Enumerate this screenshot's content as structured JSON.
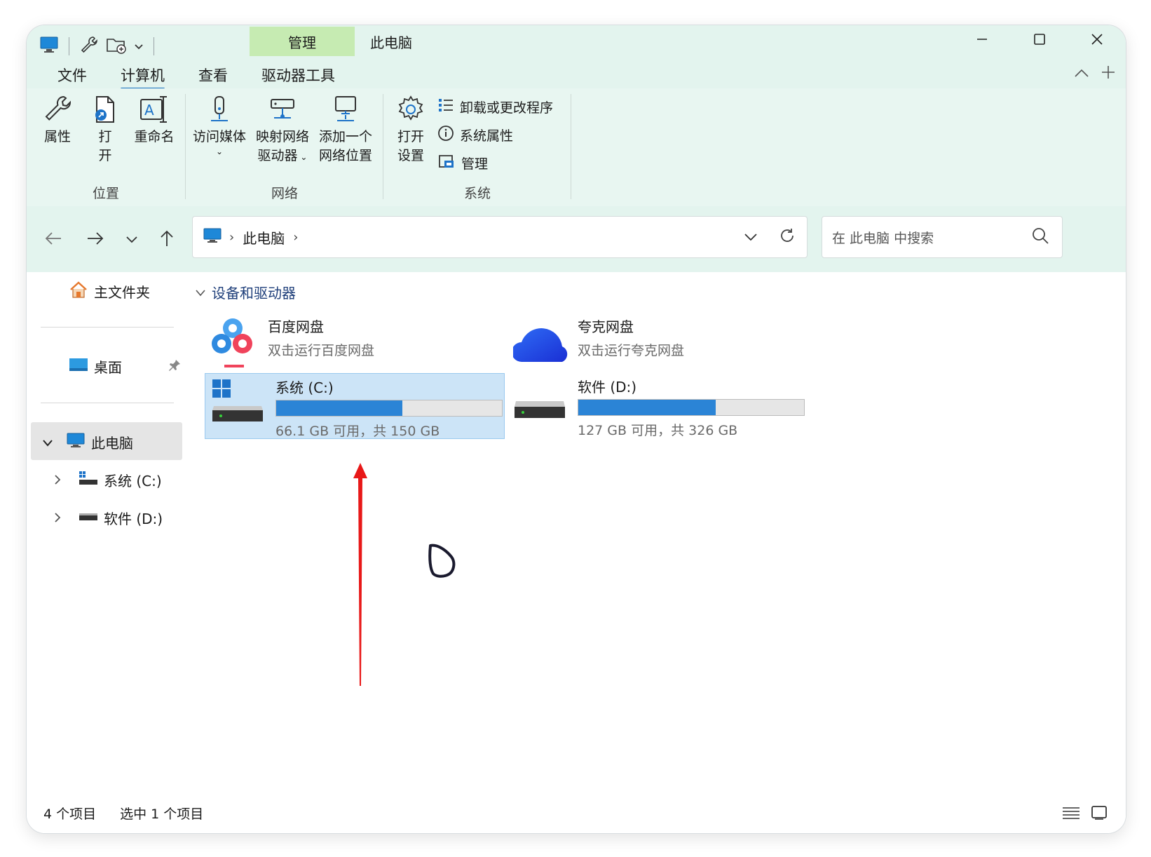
{
  "window": {
    "title": "此电脑",
    "context_tab": "管理"
  },
  "menu_tabs": [
    {
      "label": "文件"
    },
    {
      "label": "计算机"
    },
    {
      "label": "查看"
    },
    {
      "label": "驱动器工具"
    }
  ],
  "ribbon": {
    "location": {
      "label": "位置",
      "properties": "属性",
      "open_line1": "打",
      "open_line2": "开",
      "rename": "重命名"
    },
    "network": {
      "label": "网络",
      "access_media": "访问媒体",
      "map_drive_line1": "映射网络",
      "map_drive_line2": "驱动器",
      "add_location_line1": "添加一个",
      "add_location_line2": "网络位置"
    },
    "system": {
      "label": "系统",
      "open_settings_line1": "打开",
      "open_settings_line2": "设置",
      "uninstall": "卸载或更改程序",
      "system_properties": "系统属性",
      "manage": "管理"
    }
  },
  "address": {
    "path": "此电脑",
    "search_placeholder": "在 此电脑 中搜索"
  },
  "sidebar": {
    "home": "主文件夹",
    "desktop": "桌面",
    "this_pc": "此电脑",
    "drive_c": "系统 (C:)",
    "drive_d": "软件 (D:)"
  },
  "main": {
    "section_title": "设备和驱动器",
    "items": [
      {
        "name": "百度网盘",
        "subtitle": "双击运行百度网盘"
      },
      {
        "name": "夸克网盘",
        "subtitle": "双击运行夸克网盘"
      },
      {
        "name": "系统 (C:)",
        "subtitle": "66.1 GB 可用，共 150 GB",
        "used_fraction": 0.56
      },
      {
        "name": "软件 (D:)",
        "subtitle": "127 GB 可用，共 326 GB",
        "used_fraction": 0.61
      }
    ]
  },
  "status": {
    "count": "4 个项目",
    "selected": "选中 1 个项目"
  },
  "colors": {
    "accent": "#0f6cbd",
    "ribbon_bg": "#e8f6f1",
    "context_tab_bg": "#c6ebb2",
    "selection_bg": "#cce4f7",
    "usage_bar": "#2b84d6",
    "annotation_arrow": "#e81818"
  }
}
